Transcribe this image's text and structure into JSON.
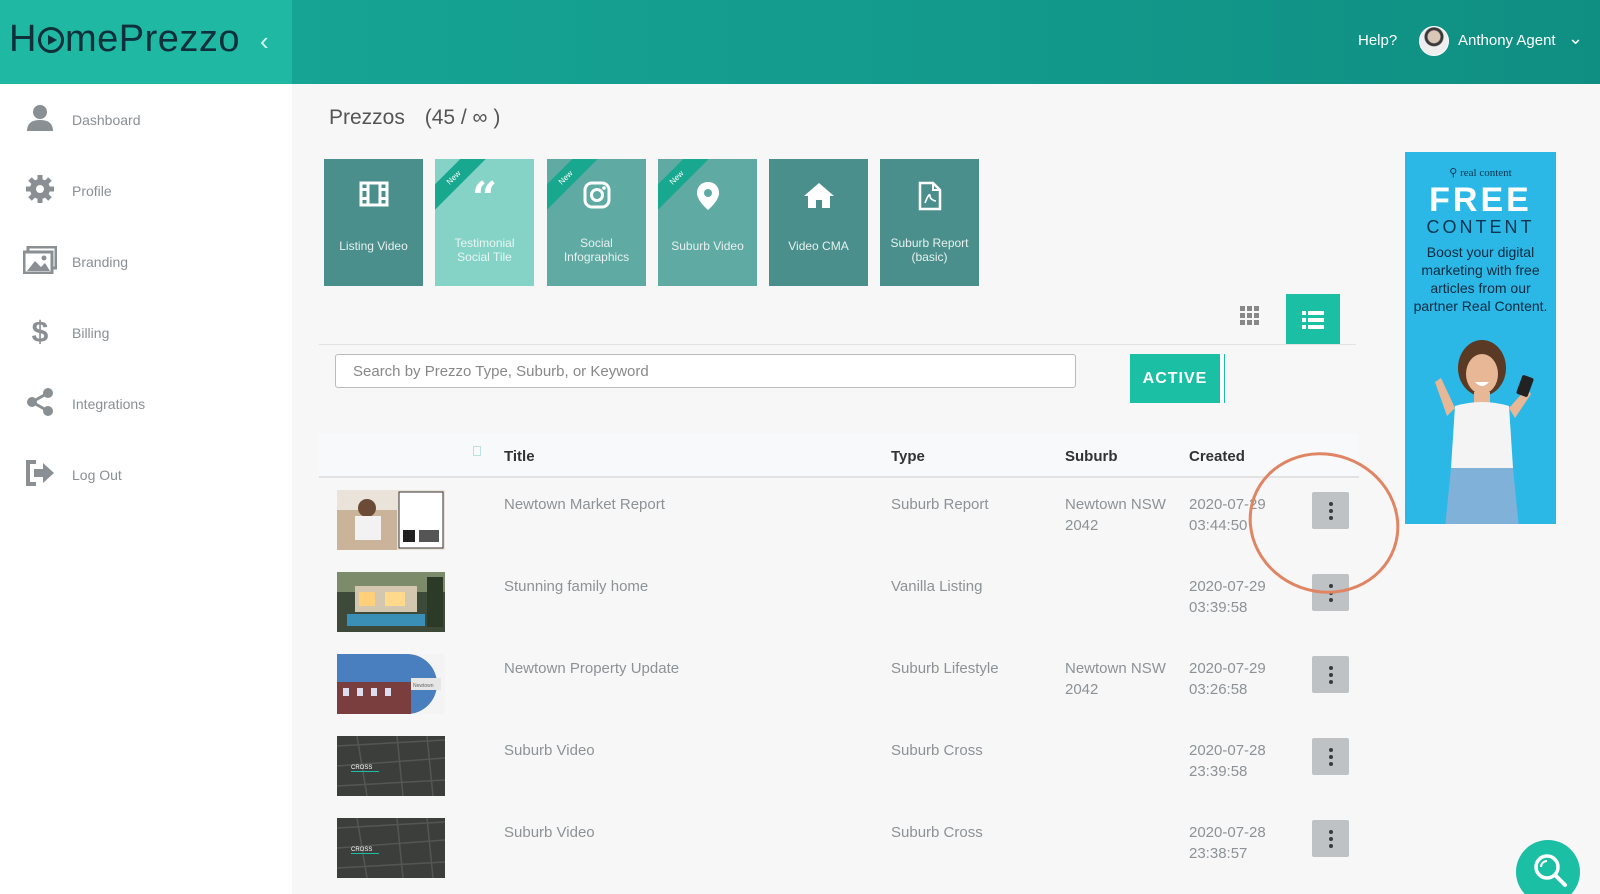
{
  "header": {
    "logo": "HomePrezzo",
    "help": "Help?",
    "user_name": "Anthony Agent"
  },
  "sidebar": {
    "items": [
      {
        "label": "Dashboard",
        "icon": "user-icon"
      },
      {
        "label": "Profile",
        "icon": "gear-icon"
      },
      {
        "label": "Branding",
        "icon": "image-icon"
      },
      {
        "label": "Billing",
        "icon": "dollar-icon"
      },
      {
        "label": "Integrations",
        "icon": "share-icon"
      },
      {
        "label": "Log Out",
        "icon": "logout-icon"
      }
    ]
  },
  "main": {
    "title": "Prezzos",
    "count": "(45 / ∞ )",
    "tiles": [
      {
        "label": "Listing Video",
        "icon": "film-icon",
        "new": false
      },
      {
        "label": "Testimonial Social Tile",
        "icon": "quote-icon",
        "new": true,
        "ribbon": "New"
      },
      {
        "label": "Social Infographics",
        "icon": "instagram-icon",
        "new": true,
        "ribbon": "New"
      },
      {
        "label": "Suburb Video",
        "icon": "map-pin-icon",
        "new": true,
        "ribbon": "New"
      },
      {
        "label": "Video CMA",
        "icon": "home-icon",
        "new": false
      },
      {
        "label": "Suburb Report (basic)",
        "icon": "pdf-icon",
        "new": false
      }
    ],
    "search_placeholder": "Search by Prezzo Type, Suburb, or Keyword",
    "filter_label": "ACTIVE",
    "table": {
      "columns": [
        "Title",
        "Type",
        "Suburb",
        "Created"
      ],
      "rows": [
        {
          "title": "Newtown Market Report",
          "type": "Suburb Report",
          "suburb": "Newtown NSW 2042",
          "created": "2020-07-29 03:44:50"
        },
        {
          "title": "Stunning family home",
          "type": "Vanilla Listing",
          "suburb": "",
          "created": "2020-07-29 03:39:58"
        },
        {
          "title": "Newtown Property Update",
          "type": "Suburb Lifestyle",
          "suburb": "Newtown NSW 2042",
          "created": "2020-07-29 03:26:58"
        },
        {
          "title": "Suburb Video",
          "type": "Suburb Cross",
          "suburb": "",
          "created": "2020-07-28 23:39:58"
        },
        {
          "title": "Suburb Video",
          "type": "Suburb Cross",
          "suburb": "",
          "created": "2020-07-28 23:38:57"
        }
      ]
    },
    "thumb_labels": {
      "newtown": "Newtown",
      "cross": "CROSS"
    }
  },
  "ad": {
    "brand": "real content",
    "headline": "FREE",
    "subhead": "CONTENT",
    "copy": "Boost your digital marketing with free articles from our partner Real Content."
  },
  "colors": {
    "accent": "#1bbfa4",
    "tile_dark": "#4a8f8c",
    "tile_light": "#85d3c7",
    "highlight": "#e08564"
  }
}
